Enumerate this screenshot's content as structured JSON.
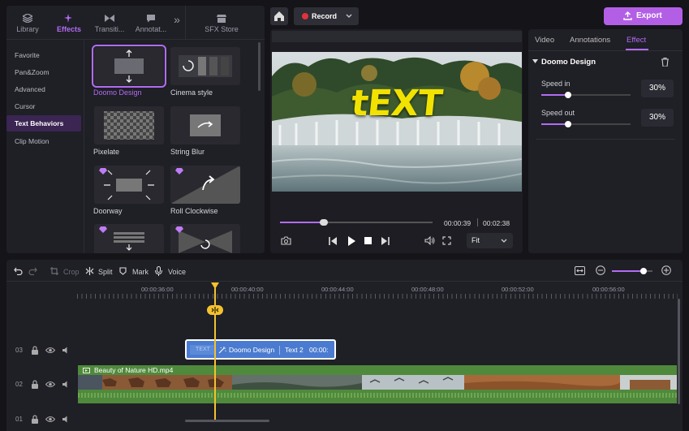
{
  "left_tabs": [
    {
      "label": "Library",
      "icon": "library-icon"
    },
    {
      "label": "Effects",
      "icon": "effects-icon",
      "active": true
    },
    {
      "label": "Transiti...",
      "icon": "transition-icon"
    },
    {
      "label": "Annotat...",
      "icon": "annotation-icon"
    },
    {
      "label": "»",
      "icon": "more-tabs-icon"
    },
    {
      "label": "SFX Store",
      "icon": "sfx-store-icon"
    }
  ],
  "categories": [
    "Favorite",
    "Pan&Zoom",
    "Advanced",
    "Cursor",
    "Text Behaviors",
    "Clip Motion"
  ],
  "active_category": "Text Behaviors",
  "effects": [
    {
      "name": "Doomo Design",
      "selected": true
    },
    {
      "name": "Cinema style"
    },
    {
      "name": "Pixelate"
    },
    {
      "name": "String Blur"
    },
    {
      "name": "Doorway",
      "premium": true
    },
    {
      "name": "Roll Clockwise",
      "premium": true
    },
    {
      "name": "",
      "premium": true
    },
    {
      "name": "",
      "premium": true
    }
  ],
  "topbar": {
    "record_label": "Record",
    "export_label": "Export"
  },
  "preview": {
    "overlay_text": "tEXT",
    "current_time": "00:00:39",
    "total_time": "00:02:38",
    "fit_label": "Fit",
    "progress": 0.27
  },
  "right_tabs": [
    "Video",
    "Annotations",
    "Effect"
  ],
  "right_active_tab": "Effect",
  "effect_panel": {
    "title": "Doomo Design",
    "speed_in_label": "Speed in",
    "speed_in_value": "30%",
    "speed_in": 0.3,
    "speed_out_label": "Speed out",
    "speed_out_value": "30%",
    "speed_out": 0.3
  },
  "toolbar": {
    "crop": "Crop",
    "split": "Split",
    "mark": "Mark",
    "voice": "Voice",
    "zoom": 0.78
  },
  "ruler": [
    "00:00:36:00",
    "00:00:40:00",
    "00:00:44:00",
    "00:00:48:00",
    "00:00:52:00",
    "00:00:56:00"
  ],
  "tracks": {
    "row_labels": [
      "03",
      "02",
      "01"
    ],
    "text_clip": {
      "text": "Doomo Design",
      "sub": "Text 2",
      "time": "00:00:",
      "thumb": "TEXT"
    },
    "video_clip": {
      "name": "Beauty of Nature HD.mp4"
    }
  },
  "colors": {
    "accent": "#b26cf2",
    "clip_blue": "#4a7bd0",
    "video_green": "#4f8a3c",
    "playhead": "#f3c230"
  }
}
